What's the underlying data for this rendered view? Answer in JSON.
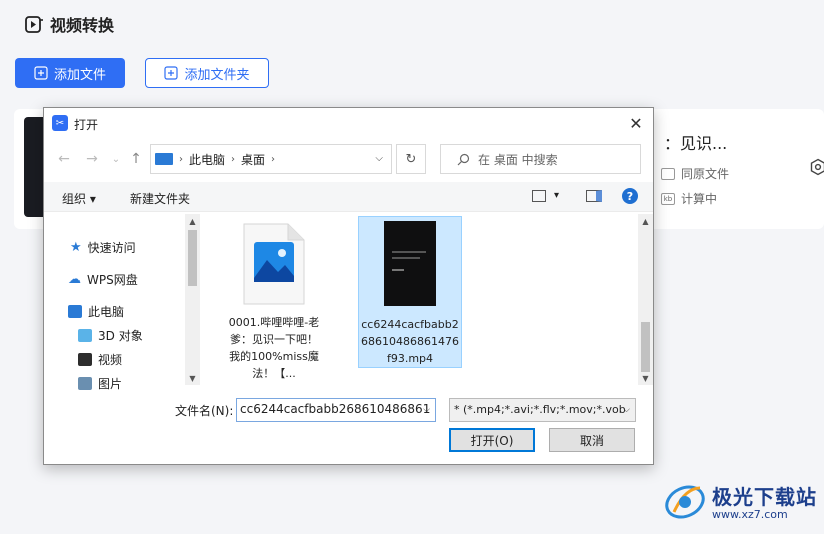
{
  "app": {
    "title": "视频转换",
    "add_file_button": "添加文件",
    "add_folder_button": "添加文件夹",
    "task": {
      "name": "：见识...",
      "option_original_folder": "同原文件",
      "status": "计算中"
    }
  },
  "dialog": {
    "title": "打开",
    "breadcrumb": [
      "此电脑",
      "桌面"
    ],
    "search_placeholder": "在 桌面 中搜索",
    "toolbar": {
      "organize_label": "组织",
      "new_folder_label": "新建文件夹"
    },
    "nav_items": [
      {
        "label": "快速访问",
        "icon": "star-icon"
      },
      {
        "label": "WPS网盘",
        "icon": "cloud-icon"
      },
      {
        "label": "此电脑",
        "icon": "computer-icon"
      },
      {
        "label": "3D 对象",
        "icon": "3d-objects-icon"
      },
      {
        "label": "视频",
        "icon": "video-folder-icon"
      },
      {
        "label": "图片",
        "icon": "pictures-folder-icon"
      }
    ],
    "files": [
      {
        "name": "0001.哔哩哔哩-老爹：见识一下吧！我的100%miss魔法！【...",
        "icon": "image-file-icon",
        "selected": false
      },
      {
        "name": "cc6244cacfbabb268610486861476f93.mp4",
        "icon": "video-thumbnail",
        "selected": true
      }
    ],
    "filename_label": "文件名(N):",
    "filename_value": "cc6244cacfbabb268610486861",
    "file_type_filter": "* (*.mp4;*.avi;*.flv;*.mov;*.vob",
    "open_button": "打开(O)",
    "cancel_button": "取消"
  },
  "watermark": {
    "name": "极光下载站",
    "url": "www.xz7.com"
  },
  "colors": {
    "accent": "#2f6ef4",
    "selection": "#cce8ff"
  }
}
